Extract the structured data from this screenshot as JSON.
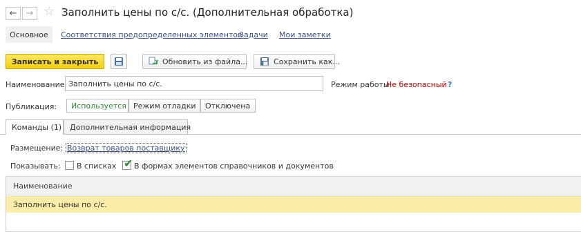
{
  "window": {
    "title": "Заполнить цены по с/с. (Дополнительная обработка)",
    "back_icon": "←",
    "forward_icon": "→",
    "favorite_icon": "☆"
  },
  "section_tabs": {
    "active": "Основное",
    "links": [
      "Соответствия предопределенных элементов",
      "Задачи",
      "Мои заметки"
    ]
  },
  "toolbar": {
    "save_close": "Записать и закрыть",
    "update_from_file": "Обновить из файла...",
    "save_as": "Сохранить как..."
  },
  "form": {
    "name_label": "Наименование:",
    "name_value": "Заполнить цены по с/с.",
    "mode_label": "Режим работы:",
    "mode_value": "Не безопасный",
    "mode_help": "?",
    "publication_label": "Публикация:",
    "publication_options": [
      "Используется",
      "Режим отладки",
      "Отключена"
    ],
    "publication_selected": "Используется"
  },
  "tabs": {
    "commands": "Команды (1)",
    "additional": "Дополнительная информация"
  },
  "commands": {
    "placement_label": "Размещение:",
    "placement_value": "Возврат товаров поставщику",
    "show_label": "Показывать:",
    "in_lists_label": "В списках",
    "in_lists_checked": false,
    "in_forms_label": "В формах элементов справочников и документов",
    "in_forms_checked": true
  },
  "table": {
    "column_header": "Наименование",
    "rows": [
      "Заполнить цены по с/с."
    ]
  },
  "colors": {
    "primary_button": "#f4cf0a",
    "selected_row": "#fbeca7",
    "link": "#3a4f8a",
    "active_segment": "#2e8b3a",
    "warning": "#c00000"
  }
}
